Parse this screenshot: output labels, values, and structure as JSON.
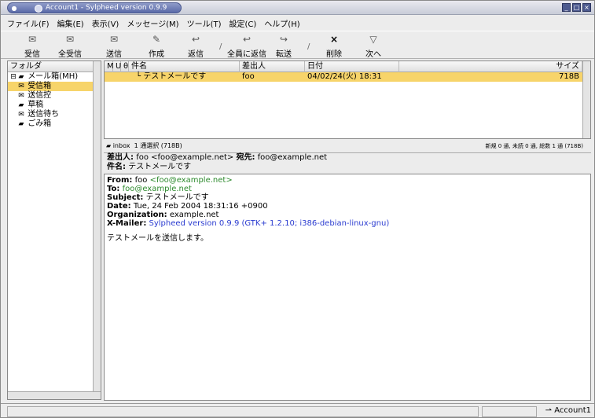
{
  "window": {
    "title": "Account1 - Sylpheed version 0.9.9"
  },
  "menubar": {
    "items": [
      "ファイル(F)",
      "編集(E)",
      "表示(V)",
      "メッセージ(M)",
      "ツール(T)",
      "設定(C)",
      "ヘルプ(H)"
    ]
  },
  "toolbar": {
    "receive": "受信",
    "receive_all": "全受信",
    "send": "送信",
    "compose": "作成",
    "reply": "返信",
    "reply_all": "全員に返信",
    "forward": "転送",
    "delete": "削除",
    "next": "次へ"
  },
  "folders": {
    "header": "フォルダ",
    "root": "メール箱(MH)",
    "items": [
      "受信箱",
      "送信控",
      "草稿",
      "送信待ち",
      "ごみ箱"
    ],
    "selected": "受信箱"
  },
  "message_list": {
    "columns": [
      "M",
      "U",
      "θ",
      "件名",
      "差出人",
      "日付",
      "サイズ"
    ],
    "rows": [
      {
        "subject": "テストメールです",
        "from": "foo",
        "date": "04/02/24(火) 18:31",
        "size": "718B"
      }
    ]
  },
  "folder_status": {
    "folder_name": "inbox",
    "selection": "1 通選択 (718B)",
    "counts": "新規 0 通, 未読 0 通, 総数 1 通 (718B)"
  },
  "message_summary": {
    "from_label": "差出人:",
    "from_value": "foo <foo@example.net>",
    "to_label": "宛先:",
    "to_value": "foo@example.net",
    "subject_label": "件名:",
    "subject_value": "テストメールです"
  },
  "message_body": {
    "from_label": "From:",
    "from_name": "foo",
    "from_addr": "<foo@example.net>",
    "to_label": "To:",
    "to_value": "foo@example.net",
    "subject_label": "Subject:",
    "subject_value": "テストメールです",
    "date_label": "Date:",
    "date_value": "Tue, 24 Feb 2004 18:31:16 +0900",
    "org_label": "Organization:",
    "org_value": "example.net",
    "mailer_label": "X-Mailer:",
    "mailer_value": "Sylpheed version 0.9.9 (GTK+ 1.2.10; i386-debian-linux-gnu)",
    "text": "テストメールを送信します。"
  },
  "statusbar": {
    "account": "Account1"
  }
}
